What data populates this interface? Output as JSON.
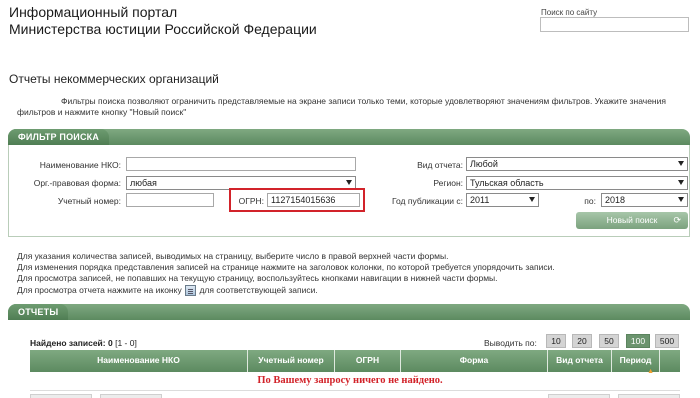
{
  "header": {
    "title_line1": "Информационный портал",
    "title_line2": "Министерства юстиции Российской Федерации"
  },
  "site_search": {
    "label": "Поиск по сайту",
    "value": ""
  },
  "page": {
    "title": "Отчеты некоммерческих организаций",
    "intro": "Фильтры поиска позволяют ограничить представляемые на экране записи только теми, которые удовлетворяют значениям фильтров. Укажите значения фильтров и нажмите кнопку \"Новый поиск\""
  },
  "filter": {
    "tab_label": "ФИЛЬТР ПОИСКА",
    "fields": {
      "nko_name": {
        "label": "Наименование НКО:",
        "value": ""
      },
      "legal_form": {
        "label": "Орг.-правовая форма:",
        "value": "любая"
      },
      "account_number": {
        "label": "Учетный номер:",
        "value": ""
      },
      "ogrn": {
        "label": "ОГРН:",
        "value": "1127154015636"
      },
      "report_type": {
        "label": "Вид отчета:",
        "value": "Любой"
      },
      "region": {
        "label": "Регион:",
        "value": "Тульская область"
      },
      "year_from": {
        "label": "Год публикации с:",
        "value": "2011"
      },
      "year_to": {
        "label": "по:",
        "value": "2018"
      }
    },
    "new_search_button": "Новый поиск",
    "refresh_glyph": "⟳"
  },
  "notes": {
    "line1": "Для указания количества записей, выводимых на страницу, выберите число в правой верхней части формы.",
    "line2": "Для изменения порядка представления записей на странице нажмите на заголовок колонки, по которой требуется упорядочить записи.",
    "line3": "Для просмотра записей, не попавших на текущую страницу, воспользуйтесь кнопками навигации в нижней части формы.",
    "line4_before": "Для просмотра отчета нажмите на иконку",
    "line4_after": "для соответствующей записи."
  },
  "reports": {
    "tab_label": "ОТЧЕТЫ",
    "found_label": "Найдено записей:",
    "found_count": "0",
    "range": "[1 - 0]",
    "show_by_label": "Выводить по:",
    "page_sizes": [
      "10",
      "20",
      "50",
      "100",
      "500"
    ],
    "active_page_size": "100",
    "columns": [
      "Наименование НКО",
      "Учетный номер",
      "ОГРН",
      "Форма",
      "Вид отчета",
      "Период"
    ],
    "sort_mark": "▲",
    "no_results": "По Вашему запросу ничего не найдено."
  },
  "colors": {
    "accent_green": "#5c8a60",
    "highlight_red": "#d2232a"
  }
}
